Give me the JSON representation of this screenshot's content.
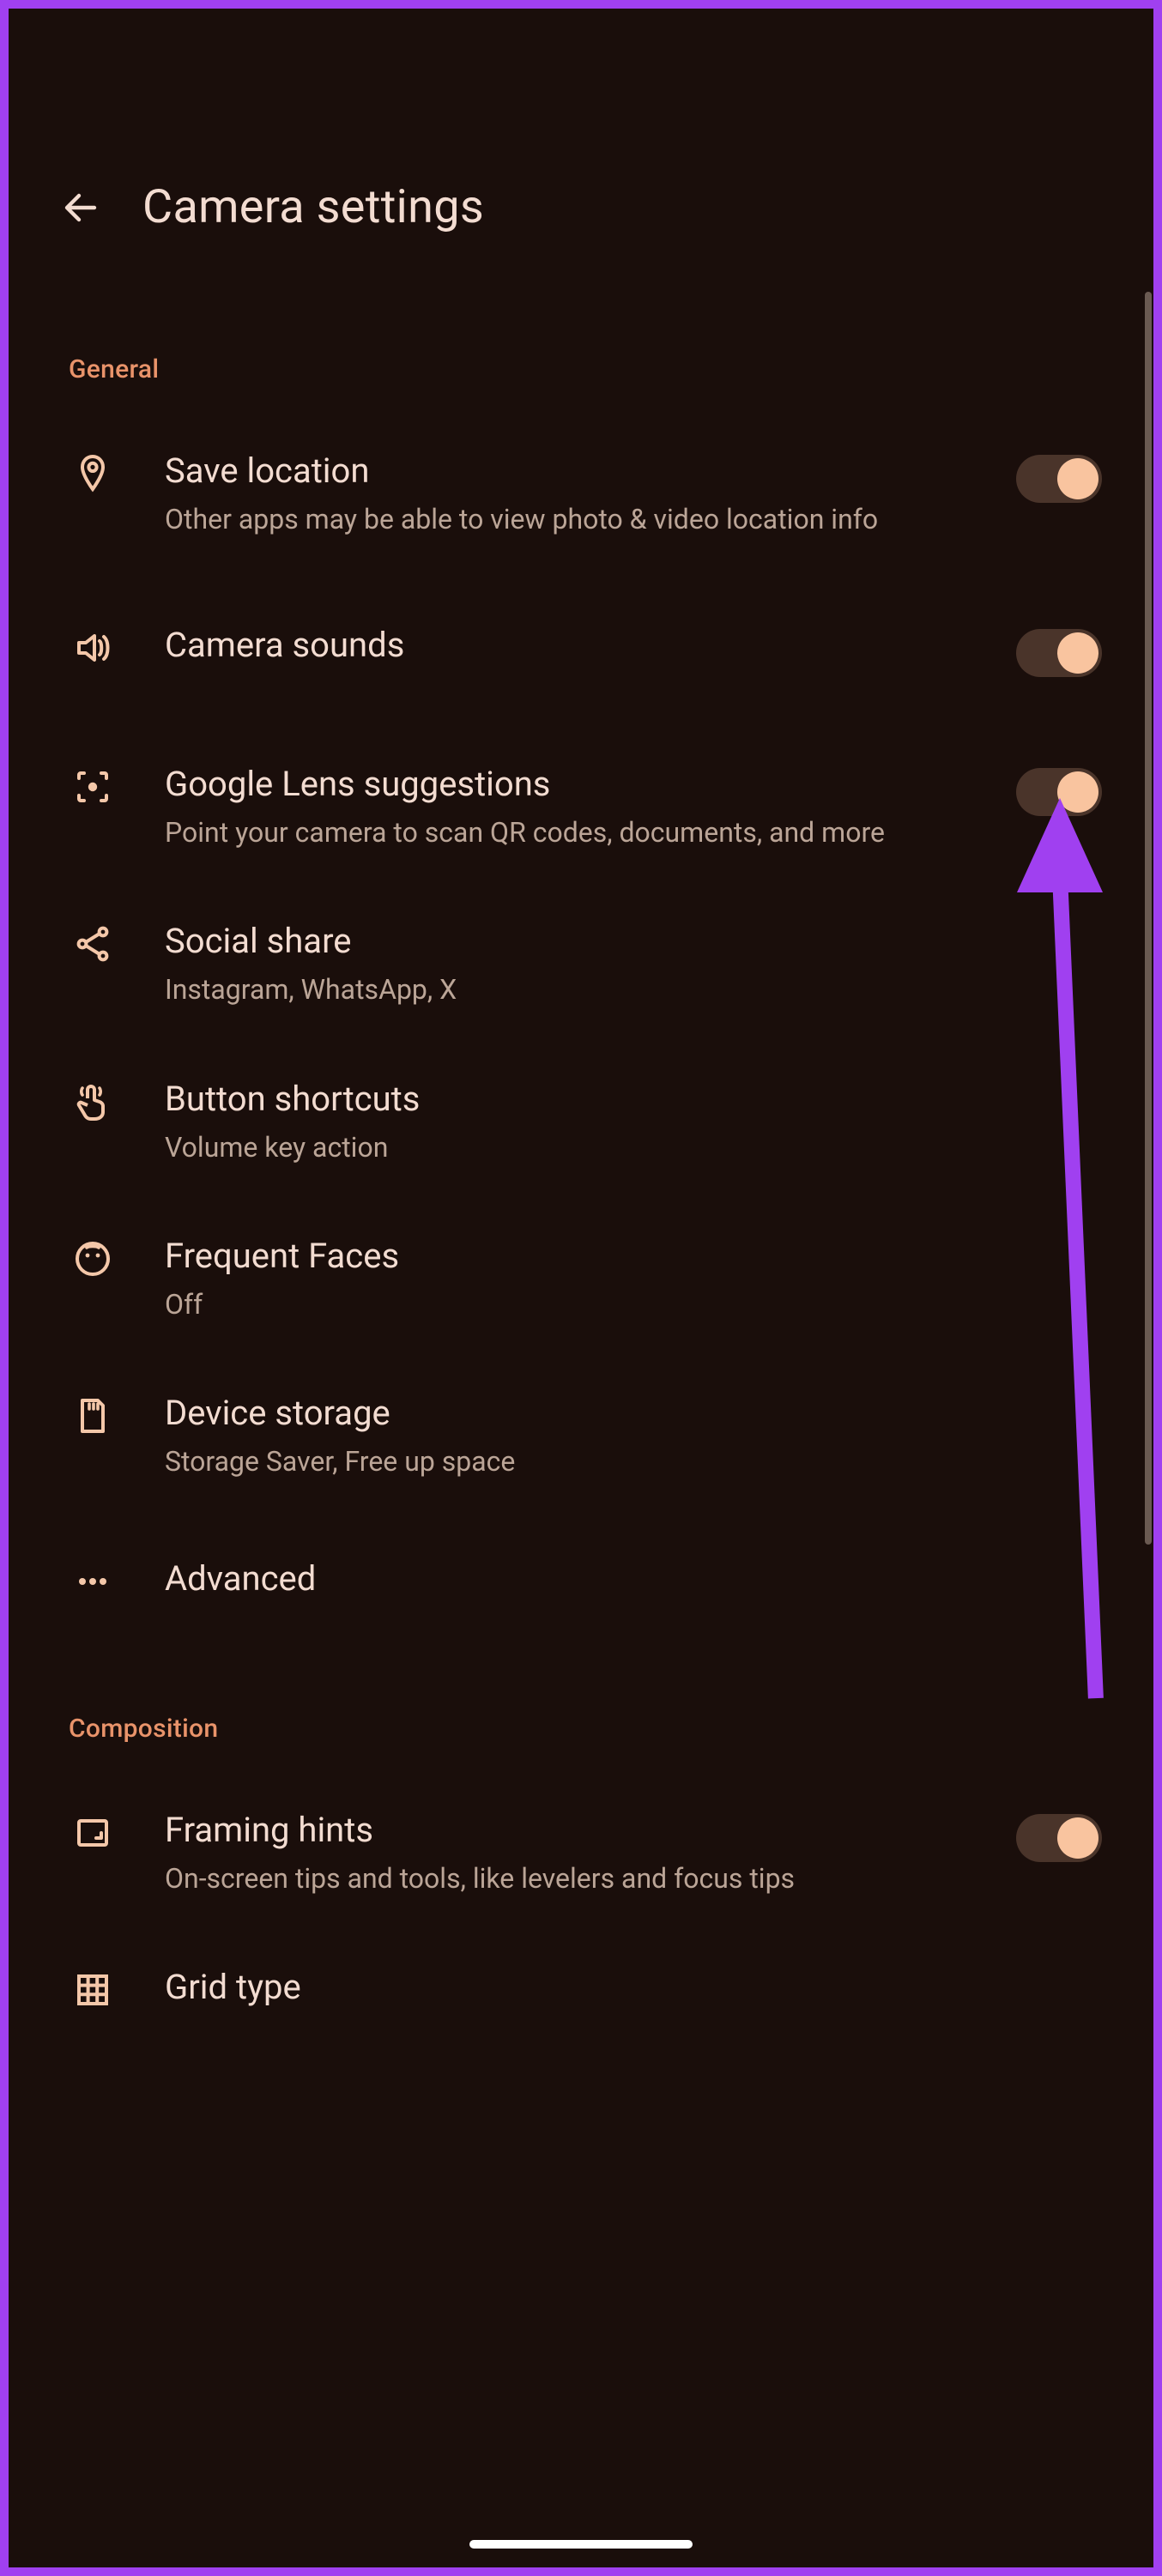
{
  "header": {
    "title": "Camera settings"
  },
  "sections": {
    "general": {
      "label": "General",
      "save_location": {
        "title": "Save location",
        "desc": "Other apps may be able to view photo & video location info",
        "toggle": true
      },
      "camera_sounds": {
        "title": "Camera sounds",
        "toggle": true
      },
      "lens_suggestions": {
        "title": "Google Lens suggestions",
        "desc": "Point your camera to scan QR codes, documents, and more",
        "toggle": true
      },
      "social_share": {
        "title": "Social share",
        "desc": "Instagram, WhatsApp, X"
      },
      "button_shortcuts": {
        "title": "Button shortcuts",
        "desc": "Volume key action"
      },
      "frequent_faces": {
        "title": "Frequent Faces",
        "desc": "Off"
      },
      "device_storage": {
        "title": "Device storage",
        "desc": "Storage Saver, Free up space"
      },
      "advanced": {
        "title": "Advanced"
      }
    },
    "composition": {
      "label": "Composition",
      "framing_hints": {
        "title": "Framing hints",
        "desc": "On-screen tips and tools, like levelers and focus tips",
        "toggle": true
      },
      "grid_type": {
        "title": "Grid type"
      }
    }
  }
}
